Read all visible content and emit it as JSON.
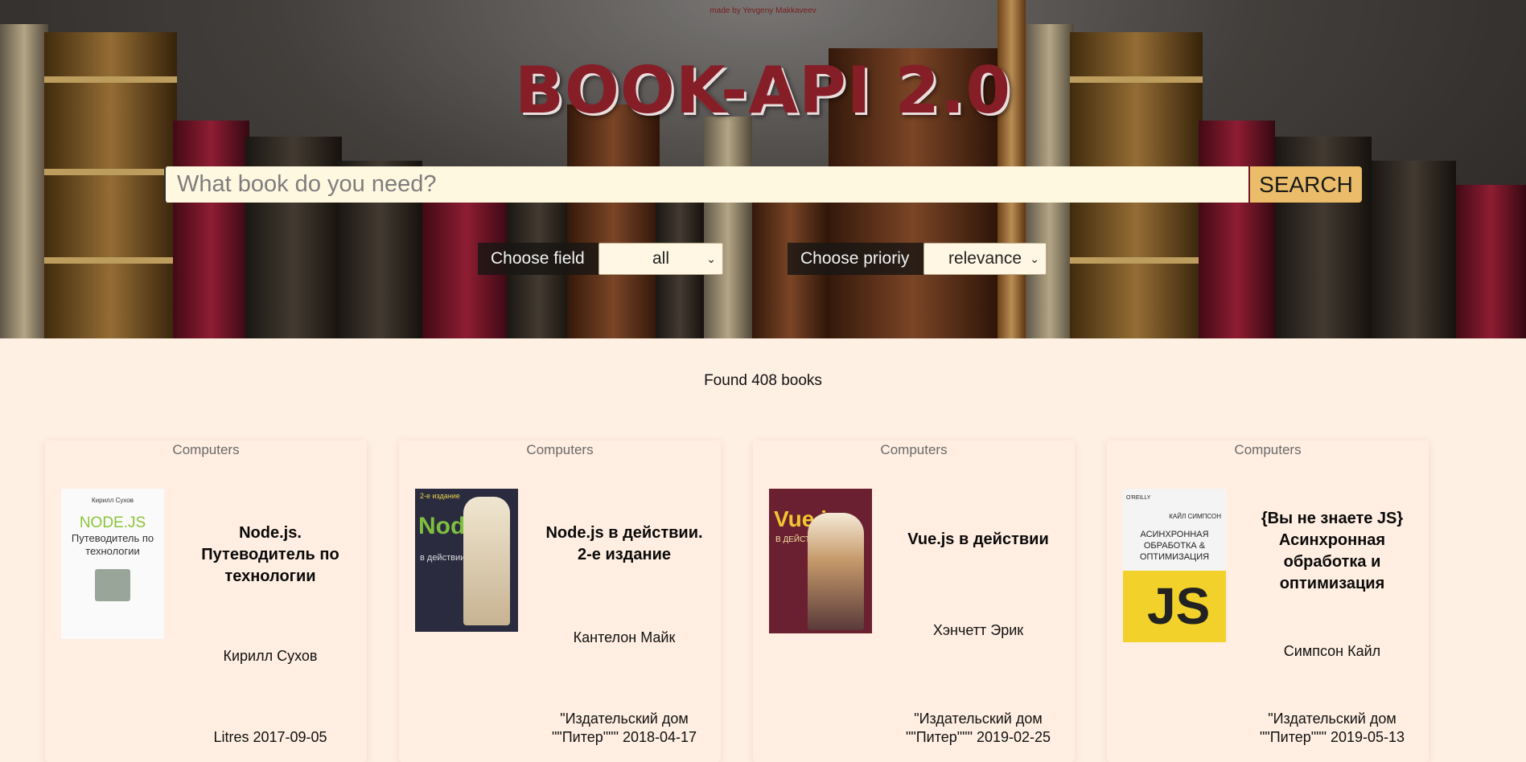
{
  "header": {
    "credit": "made by Yevgeny Makkaveev",
    "title": "BOOK-API 2.0"
  },
  "search": {
    "placeholder": "What book do you need?",
    "value": "",
    "button_label": "SEARCH"
  },
  "filters": {
    "field_label": "Choose field",
    "field_value": "all",
    "priority_label": "Choose prioriy",
    "priority_value": "relevance"
  },
  "results": {
    "found_text": "Found 408 books",
    "books": [
      {
        "category": "Computers",
        "title": "Node.js. Путеводитель по технологии",
        "author": "Кирилл Сухов",
        "publisher_date": "Litres 2017-09-05",
        "cover": {
          "top_text": "Кирилл Сухов",
          "main": "NODE.JS",
          "sub": "Путеводитель по технологии"
        }
      },
      {
        "category": "Computers",
        "title": "Node.js в действии. 2-е издание",
        "author": "Кантелон Майк",
        "publisher_line1": "\"Издательский дом",
        "publisher_line2": "\"\"Питер\"\"\" 2018-04-17",
        "cover": {
          "top_text": "2-е издание",
          "main": "Node.js",
          "sub": "в действии"
        }
      },
      {
        "category": "Computers",
        "title": "Vue.js в действии",
        "author": "Хэнчетт Эрик",
        "publisher_line1": "\"Издательский дом",
        "publisher_line2": "\"\"Питер\"\"\" 2019-02-25",
        "cover": {
          "main": "Vue.js",
          "sub": "В ДЕЙСТВИИ"
        }
      },
      {
        "category": "Computers",
        "title": "{Вы не знаете JS} Асинхронная обработка и оптимизация",
        "author": "Симпсон Кайл",
        "publisher_line1": "\"Издательский дом",
        "publisher_line2": "\"\"Питер\"\"\" 2019-05-13",
        "cover": {
          "top_text": "O'REILLY",
          "author": "КАЙЛ СИМПСОН",
          "main": "АСИНХРОННАЯ ОБРАБОТКА & ОПТИМИЗАЦИЯ",
          "logo": "JS"
        }
      }
    ]
  },
  "colors": {
    "page_bg": "#fff0e4",
    "title": "#861e27",
    "search_button": "#ebbd6a",
    "card_bg": "#ffeee1"
  }
}
